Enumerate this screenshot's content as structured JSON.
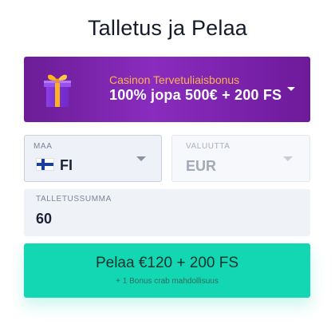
{
  "page": {
    "title": "Talletus ja Pelaa"
  },
  "bonus": {
    "subtitle": "Casinon Tervetuliaisbonus",
    "headline": "100% jopa 500€ + 200 FS",
    "icon": "gift-icon",
    "colors": {
      "background": "#8a2cbf",
      "subtitle": "#ffb24a"
    }
  },
  "country": {
    "label": "MAA",
    "value": "FI",
    "flag_icon": "finland-flag-icon"
  },
  "currency": {
    "label": "VALUUTTA",
    "value": "EUR",
    "disabled": true
  },
  "amount": {
    "label": "TALLETUSSUMMA",
    "value": "60"
  },
  "cta": {
    "label": "Pelaa €120 + 200 FS",
    "sublabel": "+ 1 Bonus crab mahdollisuus",
    "color": "#13d6b2"
  }
}
